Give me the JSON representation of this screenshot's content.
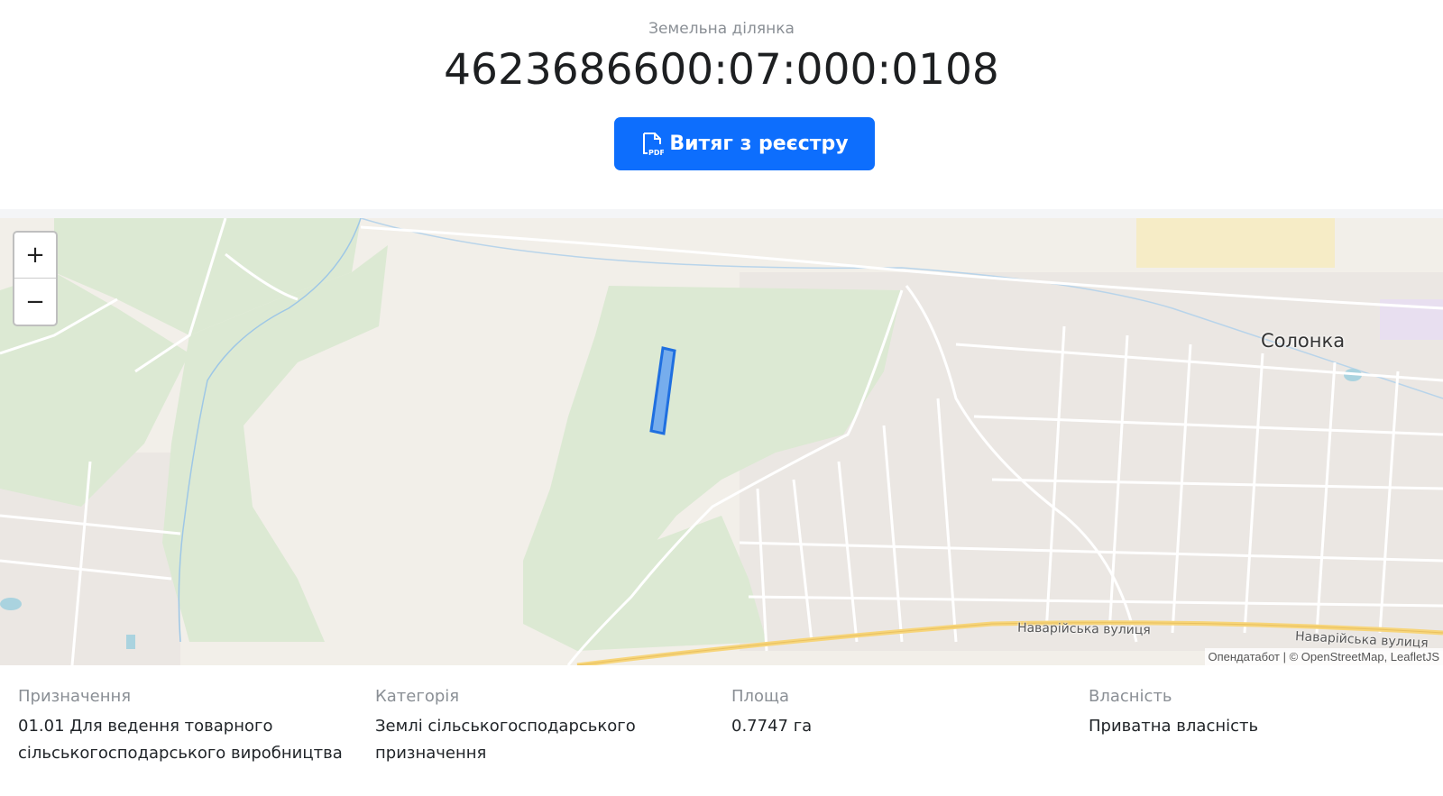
{
  "header": {
    "subtitle": "Земельна ділянка",
    "cadastral_number": "4623686600:07:000:0108",
    "extract_button_label": "Витяг з реєстру"
  },
  "map": {
    "zoom_in_label": "+",
    "zoom_out_label": "−",
    "place_label": "Солонка",
    "street_label_1": "Наварійська вулиця",
    "street_label_2": "Наварійська вулиця",
    "attribution_source": "Опендатабот",
    "attribution_separator": " | © ",
    "attribution_osm": "OpenStreetMap",
    "attribution_leaflet": "LeafletJS",
    "parcel_color": "#3a80e6"
  },
  "info": [
    {
      "label": "Призначення",
      "value": "01.01 Для ведення товарного сільськогосподарського виробництва"
    },
    {
      "label": "Категорія",
      "value": "Землі сільськогосподарського призначення"
    },
    {
      "label": "Площа",
      "value": "0.7747 га"
    },
    {
      "label": "Власність",
      "value": "Приватна власність"
    }
  ],
  "colors": {
    "button": "#0d6efd",
    "map_background": "#f2efe9",
    "green_area": "#dce9d3",
    "road_main": "#f7d57a"
  }
}
